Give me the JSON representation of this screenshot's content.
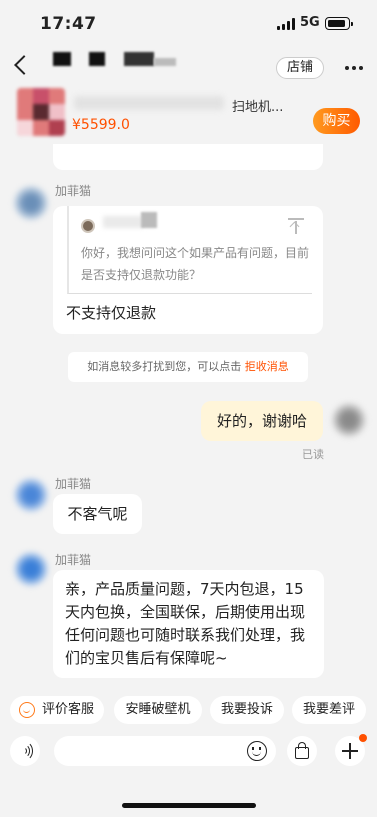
{
  "status_bar": {
    "time": "17:47",
    "network": "5G"
  },
  "header": {
    "shop_label": "店铺"
  },
  "product": {
    "name_fragment": "扫地机...",
    "price": "¥5599.0",
    "buy_label": "购买"
  },
  "messages": {
    "sender_1": "加菲猫",
    "quoted_text": "你好，我想问问这个如果产品有问题，目前是否支持仅退款功能？",
    "answer": "不支持仅退款",
    "notice_prefix": "如消息较多打扰到您，可以点击",
    "notice_link": "拒收消息",
    "my_reply": "好的，谢谢哈",
    "read_status": "已读",
    "sender_2": "加菲猫",
    "reply_2": "不客气呢",
    "sender_3": "加菲猫",
    "reply_3": "亲，产品质量问题，7天内包退，15天内包换，全国联保，后期使用出现任何问题也可随时联系我们处理，我们的宝贝售后有保障呢~"
  },
  "quick_replies": [
    "评价客服",
    "安睡破壁机",
    "我要投诉",
    "我要差评"
  ],
  "input": {
    "placeholder": ""
  },
  "colors": {
    "accent": "#ff5000",
    "my_bubble": "#fff5d9",
    "background": "#f3f3f3"
  }
}
